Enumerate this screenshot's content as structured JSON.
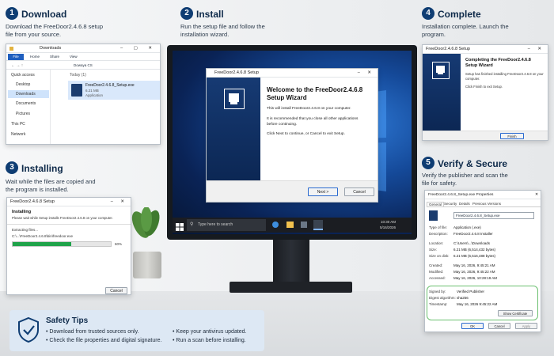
{
  "steps": [
    {
      "num": "1",
      "title": "Download",
      "desc": "Download the FreeDoor2.4.6.8 setup file from your source."
    },
    {
      "num": "2",
      "title": "Install",
      "desc": "Run the setup file and follow the installation wizard."
    },
    {
      "num": "3",
      "title": "Installing",
      "desc": "Wait while the files are copied and the program is installed."
    },
    {
      "num": "4",
      "title": "Complete",
      "desc": "Installation complete. Launch the program."
    },
    {
      "num": "5",
      "title": "Verify & Secure",
      "desc": "Verify the publisher and scan the file for safety."
    }
  ],
  "explorer": {
    "title": "Downloads",
    "ribbon_tabs": [
      "File",
      "Home",
      "Share",
      "View"
    ],
    "path": "Dowaya CS",
    "sidebar": [
      "Quick access",
      "Desktop",
      "Downloads",
      "Documents",
      "Pictures",
      "This PC",
      "Network"
    ],
    "group_label": "Today (1)",
    "file_name": "FreeDoor2.4.6.8_Setup.exe",
    "file_size": "6.21 MB",
    "file_type": "Application"
  },
  "wizard": {
    "title": "FreeDoor2.4.6.8 Setup",
    "heading_line1": "Welcome to the FreeDoor2.4.6.8",
    "heading_line2": "Setup Wizard",
    "para1": "This will install FreeDoor2.4.6.8 on your computer.",
    "para2": "It is recommended that you close all other applications before continuing.",
    "para3": "Click Next to continue, or Cancel to exit Setup.",
    "next_label": "Next >",
    "cancel_label": "Cancel"
  },
  "taskbar": {
    "search_placeholder": "Type here to search",
    "time": "10:30 AM",
    "date": "5/16/2026"
  },
  "installing": {
    "title": "FreeDoor2.4.6.8 Setup",
    "heading": "Installing",
    "subheading": "Please wait while Setup installs FreeDoor2.4.6.8 on your computer.",
    "extracting_label": "Extracting files...",
    "path": "C:\\...\\FreeDoor2.4.6.8\\bin\\freedoor.exe",
    "progress_percent": 60,
    "progress_label": "60%",
    "cancel_label": "Cancel"
  },
  "complete": {
    "title": "FreeDoor2.4.6.8 Setup",
    "heading_line1": "Completing the FreeDoor2.4.6.8",
    "heading_line2": "Setup Wizard",
    "para1": "Setup has finished installing FreeDoor2.4.6.8 on your computer.",
    "para2": "Click Finish to exit Setup.",
    "finish_label": "Finish"
  },
  "properties": {
    "title": "FreeDoor2.4.6.8_Setup.exe Properties",
    "tabs": [
      "General",
      "Security",
      "Details",
      "Previous Versions"
    ],
    "file_name": "FreeDoor2.4.6.8_Setup.exe",
    "rows": [
      {
        "label": "Type of file:",
        "value": "Application (.exe)"
      },
      {
        "label": "Description:",
        "value": "FreeDoor2.4.6.8 Installer"
      },
      {
        "label": "Location:",
        "value": "C:\\Users\\...\\Downloads"
      },
      {
        "label": "Size:",
        "value": "6.21 MB (6,514,432 bytes)"
      },
      {
        "label": "Size on disk:",
        "value": "6.21 MB (6,516,488 bytes)"
      },
      {
        "label": "Created:",
        "value": "May 16, 2026, 9:45:21 AM"
      },
      {
        "label": "Modified:",
        "value": "May 16, 2026, 9:45:22 AM"
      },
      {
        "label": "Accessed:",
        "value": "May 16, 2026, 10:28:19 AM"
      }
    ],
    "sig_rows": [
      {
        "label": "Signed by:",
        "value": "Verified Publisher"
      },
      {
        "label": "Digest algorithm:",
        "value": "sha256"
      },
      {
        "label": "Timestamp:",
        "value": "May 16, 2026 9:45:22 AM"
      }
    ],
    "show_cert_label": "Show Certificate",
    "ok_label": "OK",
    "cancel_label": "Cancel",
    "apply_label": "Apply"
  },
  "tips": {
    "title": "Safety Tips",
    "items": [
      "Download from trusted sources only.",
      "Check the file properties and digital signature.",
      "Keep your antivirus updated.",
      "Run a scan before installing."
    ]
  },
  "colors": {
    "navy": "#0f3d73",
    "accent": "#2a6ad0",
    "progress": "#1fa34a",
    "sig_border": "#6cc070"
  }
}
